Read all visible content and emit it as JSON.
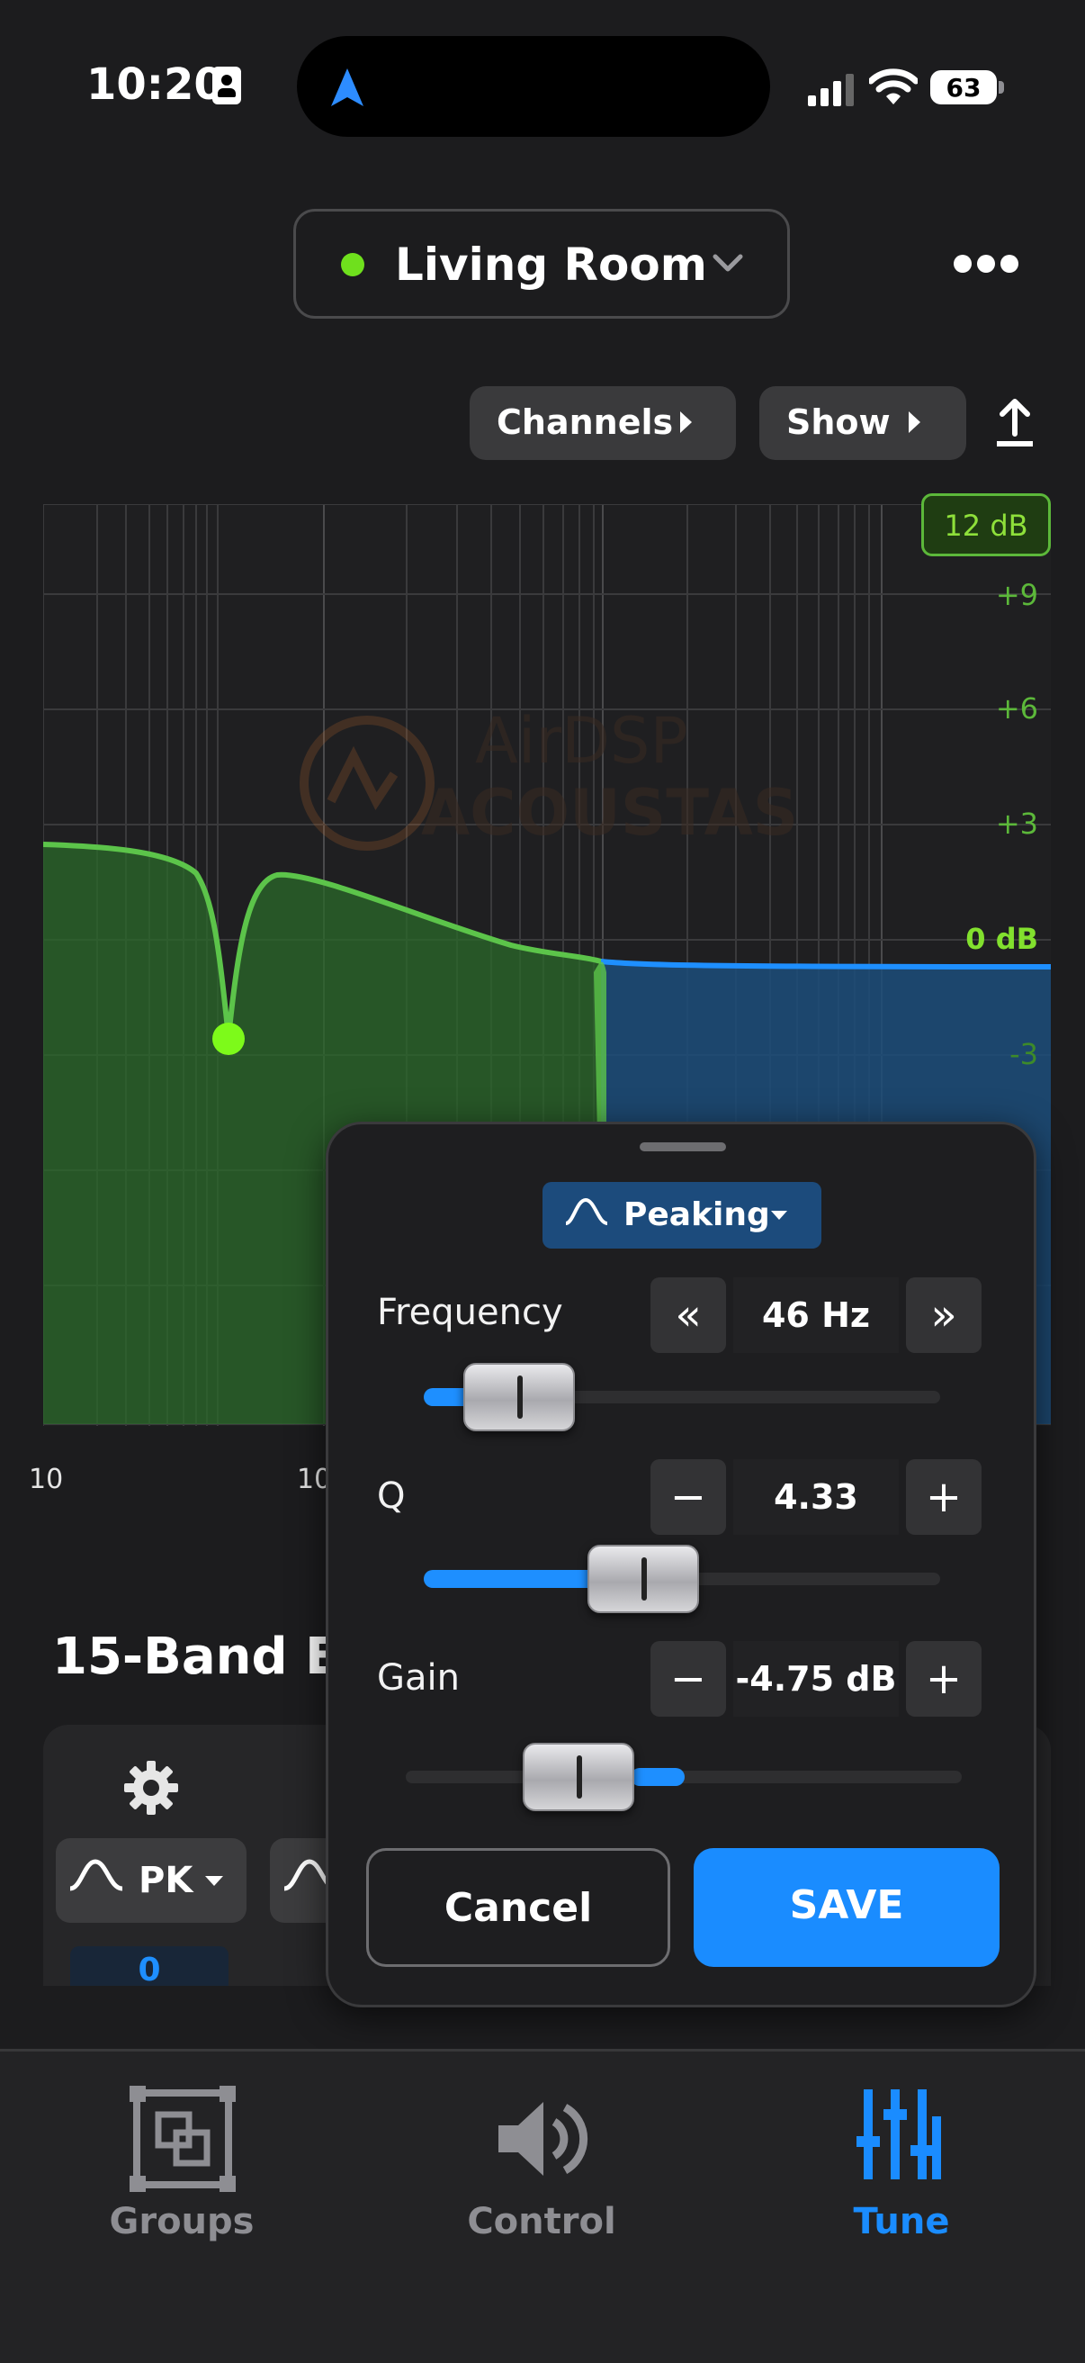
{
  "status_bar": {
    "time": "10:20",
    "battery": "63"
  },
  "header": {
    "room_name": "Living Room",
    "room_status_color": "#6fe01d",
    "more_icon": "ellipsis-icon"
  },
  "toolbar": {
    "channels_label": "Channels",
    "show_label": "Show",
    "export_icon": "share-upload-icon"
  },
  "graph": {
    "range_badge": "12 dB",
    "db_labels": [
      "+9",
      "+6",
      "+3",
      "0 dB",
      "-3"
    ],
    "x_labels": [
      "10",
      "10"
    ],
    "watermark_line1": "AirDSP",
    "watermark_line2": "ACOUSTAS",
    "curve_colors": {
      "low": "#5cc44a",
      "high": "#1e8fff",
      "handle": "#7dfa1a"
    }
  },
  "section": {
    "title": "15-Band EQ",
    "first_band_type": "PK",
    "first_band_value": "0"
  },
  "popover": {
    "filter_type": "Peaking",
    "frequency": {
      "label": "Frequency",
      "value": "46 Hz",
      "level": 0.12
    },
    "q": {
      "label": "Q",
      "value": "4.33",
      "level": 0.43
    },
    "gain": {
      "label": "Gain",
      "value": "-4.75 dB",
      "level": 0.31
    },
    "cancel_label": "Cancel",
    "save_label": "SAVE"
  },
  "tabs": [
    {
      "label": "Groups",
      "icon": "groups-icon",
      "active": false
    },
    {
      "label": "Control",
      "icon": "speaker-icon",
      "active": false
    },
    {
      "label": "Tune",
      "icon": "sliders-icon",
      "active": true
    }
  ],
  "colors": {
    "accent": "#1a8cff",
    "bg": "#1c1c1e",
    "green": "#6fe01d"
  }
}
